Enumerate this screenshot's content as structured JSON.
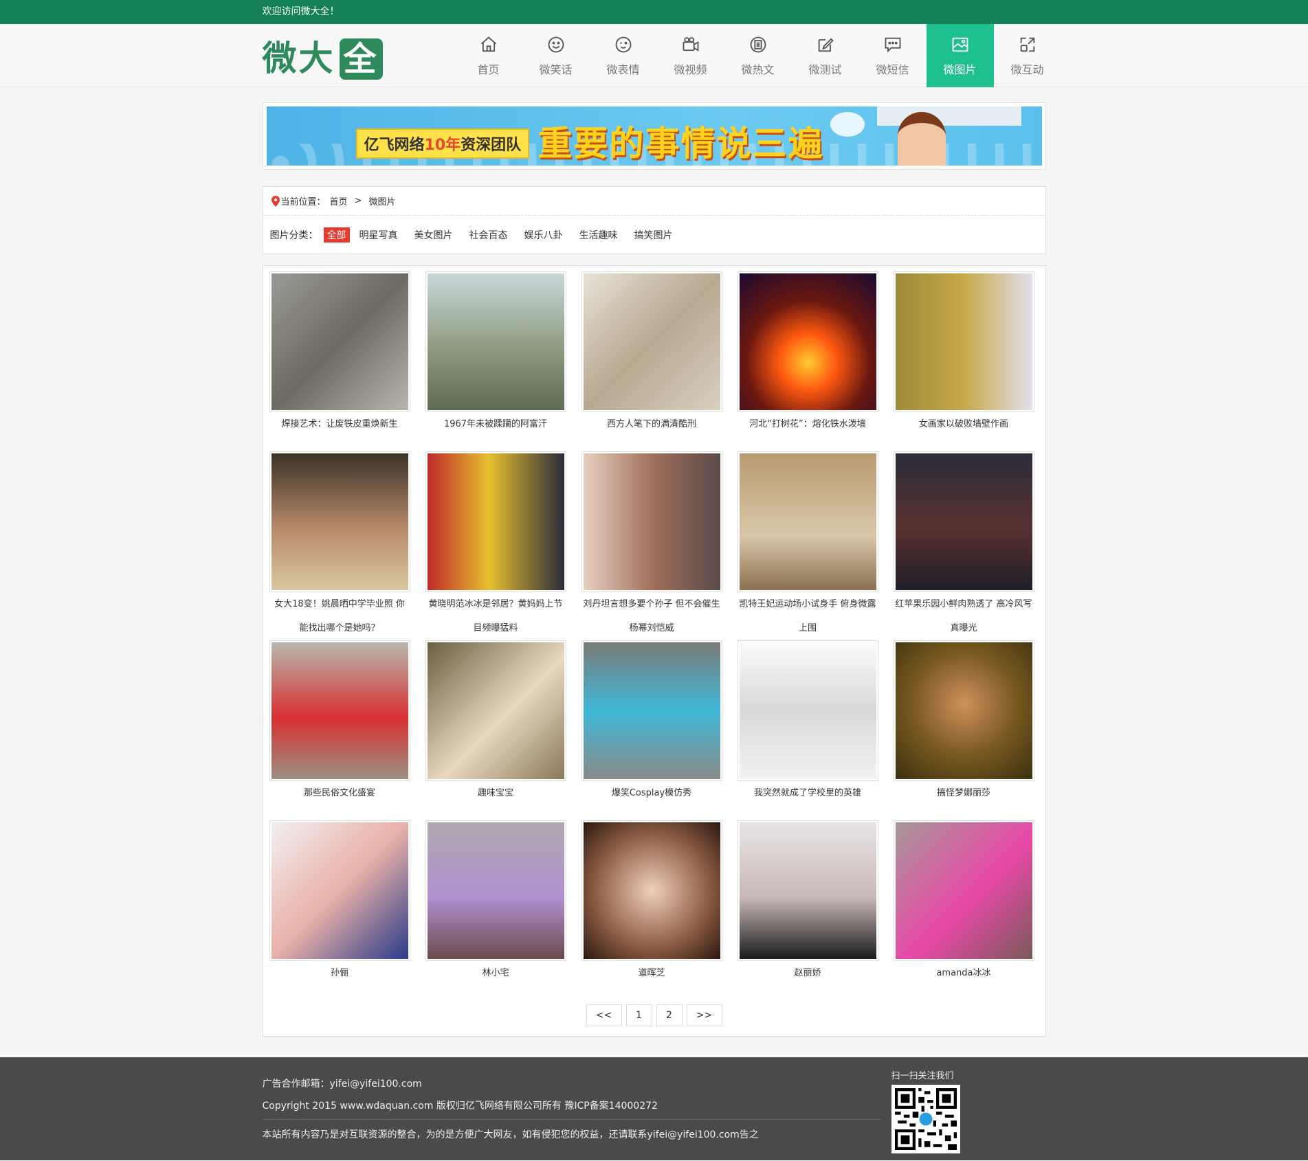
{
  "topbar": {
    "welcome": "欢迎访问微大全！"
  },
  "logo": {
    "part1": "微大",
    "part2": "全"
  },
  "nav": [
    {
      "label": "首页",
      "icon": "home-icon"
    },
    {
      "label": "微笑话",
      "icon": "smile-icon"
    },
    {
      "label": "微表情",
      "icon": "wink-icon"
    },
    {
      "label": "微视频",
      "icon": "video-camera-icon"
    },
    {
      "label": "微热文",
      "icon": "article-icon"
    },
    {
      "label": "微测试",
      "icon": "edit-icon"
    },
    {
      "label": "微短信",
      "icon": "message-icon"
    },
    {
      "label": "微图片",
      "icon": "image-icon"
    },
    {
      "label": "微互动",
      "icon": "interact-icon"
    }
  ],
  "banner": {
    "tag_prefix": "亿飞网络",
    "tag_highlight": "10年",
    "tag_suffix": "资深团队",
    "title": "重要的事情说三遍"
  },
  "breadcrumb": {
    "label": "当前位置：",
    "home": "首页",
    "separator": ">",
    "current": "微图片"
  },
  "filter": {
    "label": "图片分类：",
    "options": [
      "全部",
      "明星写真",
      "美女图片",
      "社会百态",
      "娱乐八卦",
      "生活趣味",
      "搞笑图片"
    ],
    "active": "全部"
  },
  "gallery": {
    "items": [
      {
        "caption": "焊接艺术：让废铁皮重焕新生"
      },
      {
        "caption": "1967年未被蹂躏的阿富汗"
      },
      {
        "caption": "西方人笔下的满清酷刑"
      },
      {
        "caption": "河北“打树花”：熔化铁水泼墙"
      },
      {
        "caption": "女画家以破败墙壁作画"
      },
      {
        "caption": "女大18变！姚晨晒中学毕业照 你能找出哪个是她吗？"
      },
      {
        "caption": "黄晓明范冰冰是邻居？黄妈妈上节目频曝猛料"
      },
      {
        "caption": "刘丹坦言想多要个孙子 但不会催生杨幂刘恺威"
      },
      {
        "caption": "凯特王妃运动场小试身手 俯身微露上围"
      },
      {
        "caption": "红苹果乐园小鲜肉熟透了 高冷风写真曝光"
      },
      {
        "caption": "那些民俗文化盛宴"
      },
      {
        "caption": "趣味宝宝"
      },
      {
        "caption": "爆笑Cosplay模仿秀"
      },
      {
        "caption": "我突然就成了学校里的英雄"
      },
      {
        "caption": "搞怪梦娜丽莎"
      },
      {
        "caption": "孙俪"
      },
      {
        "caption": "林小宅"
      },
      {
        "caption": "道晖芝"
      },
      {
        "caption": "赵丽娇"
      },
      {
        "caption": "amanda冰冰"
      }
    ]
  },
  "pager": {
    "prev": "<<",
    "pages": [
      "1",
      "2"
    ],
    "next": ">>"
  },
  "footer": {
    "ad_email": "广告合作邮箱：yifei@yifei100.com",
    "copyright": "Copyright 2015 www.wdaquan.com 版权归亿飞网络有限公司所有 豫ICP备案14000272",
    "disclaimer": "本站所有内容乃是对互联资源的整合，为的是方便广大网友，如有侵犯您的权益，还请联系yifei@yifei100.com告之",
    "qr_title": "扫一扫关注我们"
  },
  "colors": {
    "topbar": "#148058",
    "nav_active": "#1fc08f",
    "filter_active": "#e8392f",
    "footer": "#4a4a4a"
  }
}
